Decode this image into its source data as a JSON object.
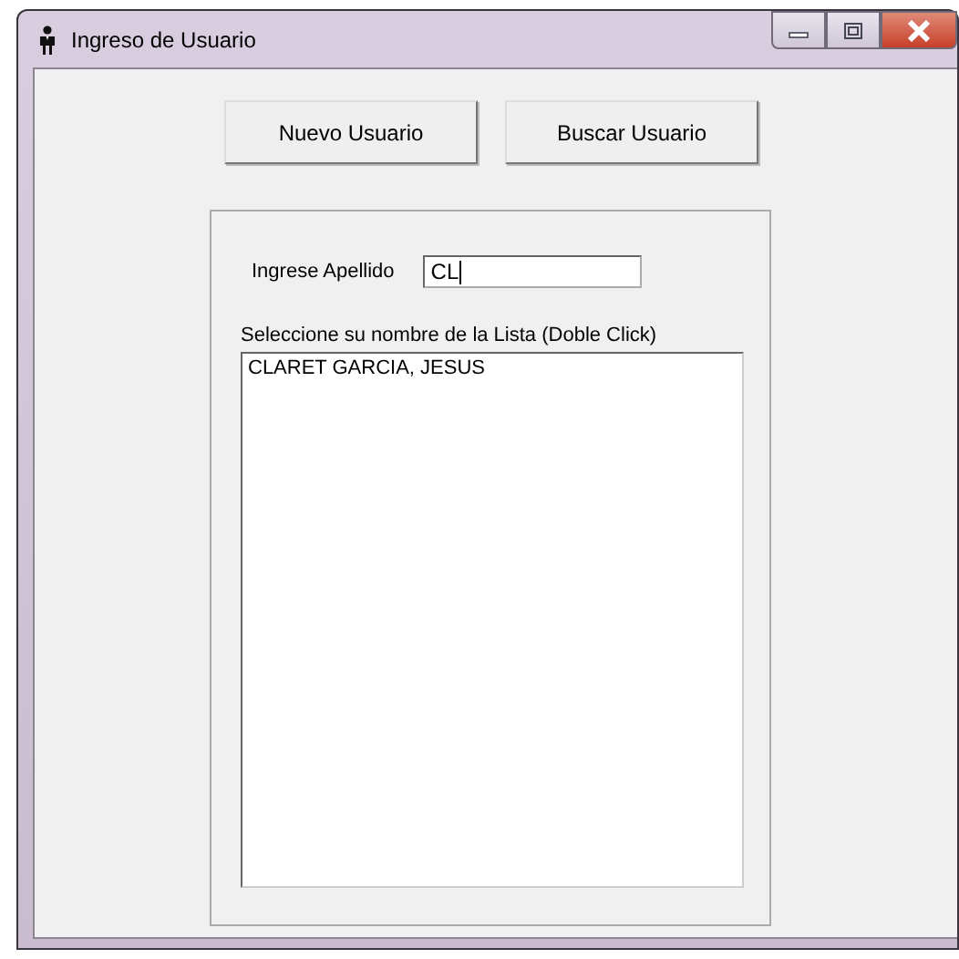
{
  "window": {
    "title": "Ingreso de Usuario"
  },
  "buttons": [
    {
      "label": "Nuevo Usuario"
    },
    {
      "label": "Buscar Usuario"
    }
  ],
  "surname": {
    "label": "Ingrese Apellido",
    "value": "CL"
  },
  "list": {
    "label": "Seleccione su nombre de la Lista (Doble Click)",
    "items": [
      {
        "text": "CLARET GARCIA, JESUS",
        "selected": false
      }
    ]
  }
}
